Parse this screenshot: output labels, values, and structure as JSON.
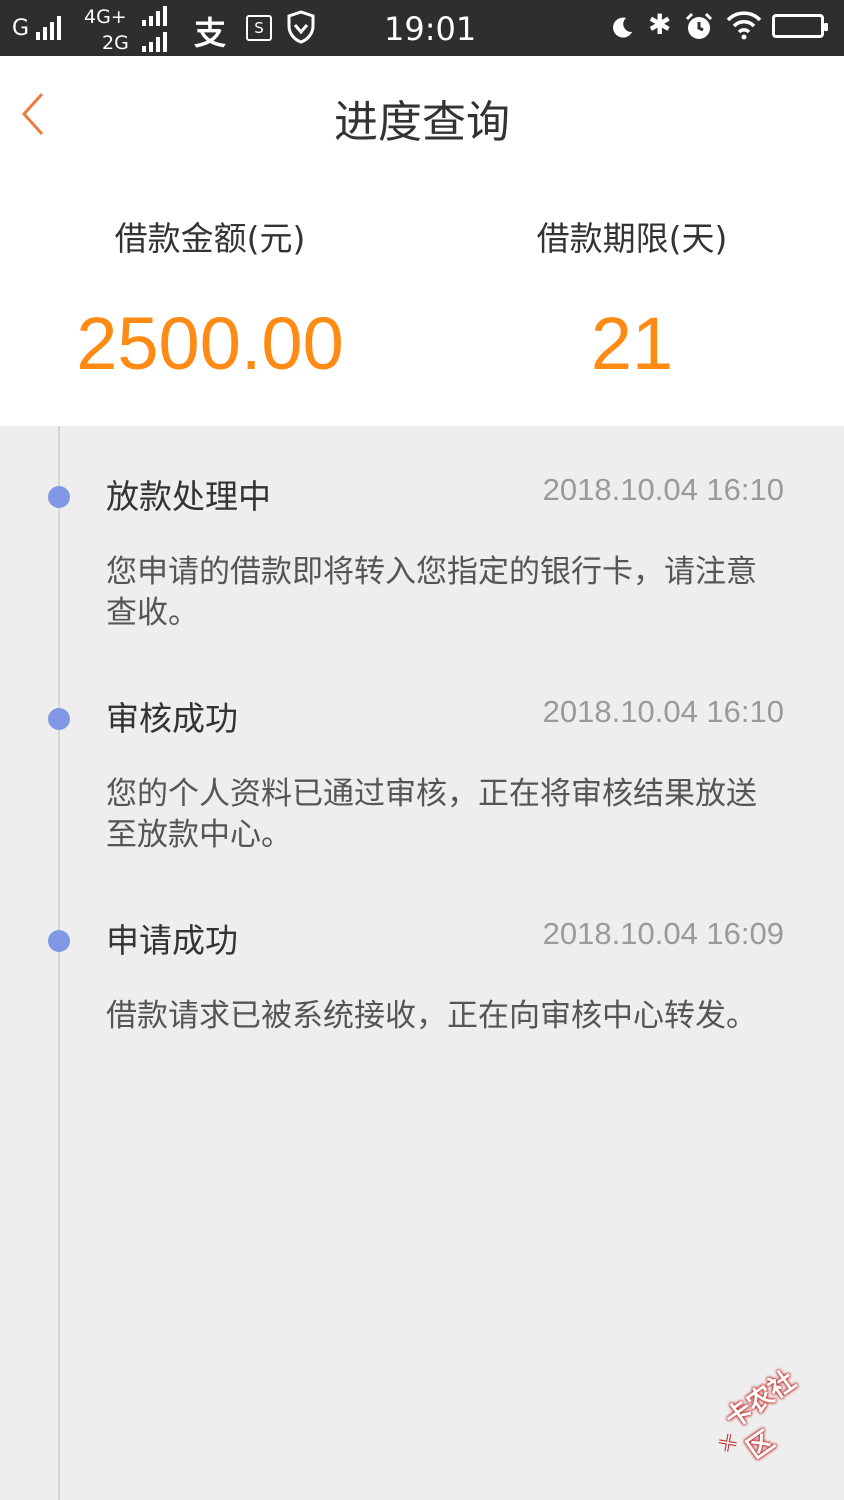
{
  "status_bar": {
    "carrier": "G",
    "network_primary": "4G+",
    "network_secondary": "2G",
    "alipay_glyph": "支",
    "sim_glyph": "S",
    "bluetooth_glyph": "✱",
    "time": "19:01"
  },
  "header": {
    "title": "进度查询",
    "back_icon": "chevron-left-icon",
    "back_color": "#f07b3f"
  },
  "summary": {
    "amount_label": "借款金额(元)",
    "amount_value": "2500.00",
    "term_label": "借款期限(天)",
    "term_value": "21",
    "value_color": "#ff8a14"
  },
  "timeline": {
    "dot_color": "#7f97e4",
    "steps": [
      {
        "title": "放款处理中",
        "time": "2018.10.04 16:10",
        "description": "您申请的借款即将转入您指定的银行卡，请注意查收。"
      },
      {
        "title": "审核成功",
        "time": "2018.10.04 16:10",
        "description": "您的个人资料已通过审核，正在将审核结果放送至放款中心。"
      },
      {
        "title": "申请成功",
        "time": "2018.10.04 16:09",
        "description": "借款请求已被系统接收，正在向审核中心转发。"
      }
    ]
  },
  "watermark": {
    "text": "卡农社区"
  }
}
